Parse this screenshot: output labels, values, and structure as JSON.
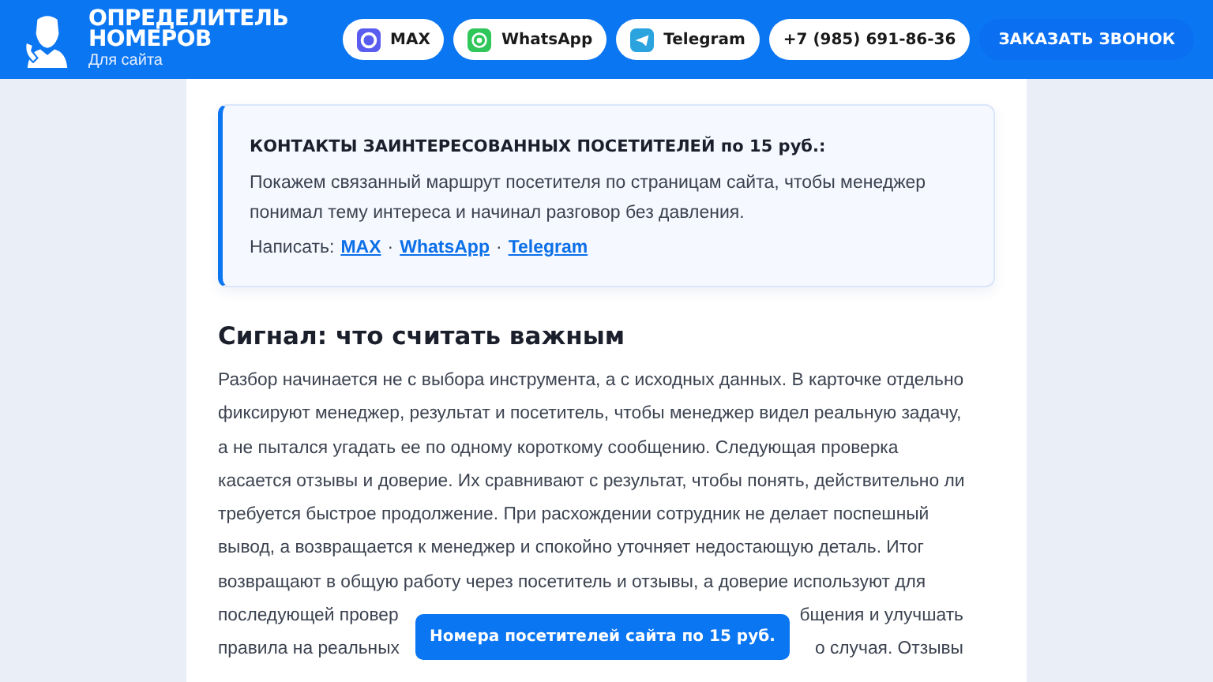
{
  "header": {
    "logo_title": "ОПРЕДЕЛИТЕЛЬ НОМЕРОВ",
    "logo_subtitle": "Для сайта",
    "contacts": [
      {
        "kind": "max",
        "label": "MAX"
      },
      {
        "kind": "whatsapp",
        "label": "WhatsApp"
      },
      {
        "kind": "telegram",
        "label": "Telegram"
      },
      {
        "kind": "phone",
        "label": "+7 (985) 691-86-36"
      }
    ],
    "call_button": "ЗАКАЗАТЬ ЗВОНОК"
  },
  "contact_box": {
    "title": "КОНТАКТЫ ЗАИНТЕРЕСОВАННЫХ ПОСЕТИТЕЛЕЙ по 15 руб.:",
    "text": "Покажем связанный маршрут посетителя по страницам сайта, чтобы менеджер понимал тему интереса и начинал разговор без давления.",
    "write_label": "Написать:",
    "separator": "·",
    "links": [
      "MAX",
      "WhatsApp",
      "Telegram"
    ]
  },
  "section": {
    "heading": "Сигнал: что считать важным",
    "lines": [
      [
        "Разбор начинается не с выбора инструмента, а с исходных данных. В карточке отдельно"
      ],
      [
        "фиксируют менеджер, результат и посетитель, чтобы менеджер видел реальную задачу,"
      ],
      [
        "а не пытался угадать ее по одному короткому сообщению. Следующая проверка"
      ],
      [
        "касается отзывы и доверие. Их сравнивают с результат, чтобы понять, действительно ли"
      ],
      [
        "требуется быстрое продолжение. При расхождении сотрудник не делает поспешный"
      ],
      [
        "вывод, а возвращается к менеджер и спокойно уточняет недостающую деталь. Итог"
      ],
      [
        "возвращают в общую работу через посетитель и отзывы, а доверие используют для"
      ],
      [
        "последующей провер",
        "бщения и улучшать"
      ],
      [
        "правила на реальных",
        "о случая. Отзывы"
      ]
    ]
  },
  "floating_button": "Номера посетителей сайта по 15 руб."
}
